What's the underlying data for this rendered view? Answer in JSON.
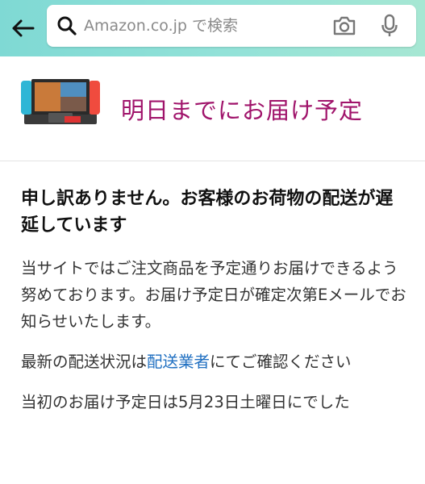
{
  "search": {
    "placeholder": "Amazon.co.jp で検索"
  },
  "banner": {
    "title": "明日までにお届け予定"
  },
  "notice": {
    "heading": "申し訳ありません。お客様のお荷物の配送が遅延しています",
    "para1": "当サイトではご注文商品を予定通りお届けできるよう努めております。お届け予定日が確定次第Eメールでお知らせいたします。",
    "para2_before": "最新の配送状況は",
    "para2_link": "配送業者",
    "para2_after": "にてご確認ください",
    "para3": "当初のお届け予定日は5月23日土曜日にでした"
  },
  "colors": {
    "header_gradient_start": "#7fd9d4",
    "header_gradient_end": "#a6e7d3",
    "delivery_title": "#a0146b",
    "link": "#1f6fc1"
  },
  "icons": {
    "back": "arrow-left-icon",
    "search": "search-icon",
    "camera": "camera-icon",
    "mic": "mic-icon"
  }
}
